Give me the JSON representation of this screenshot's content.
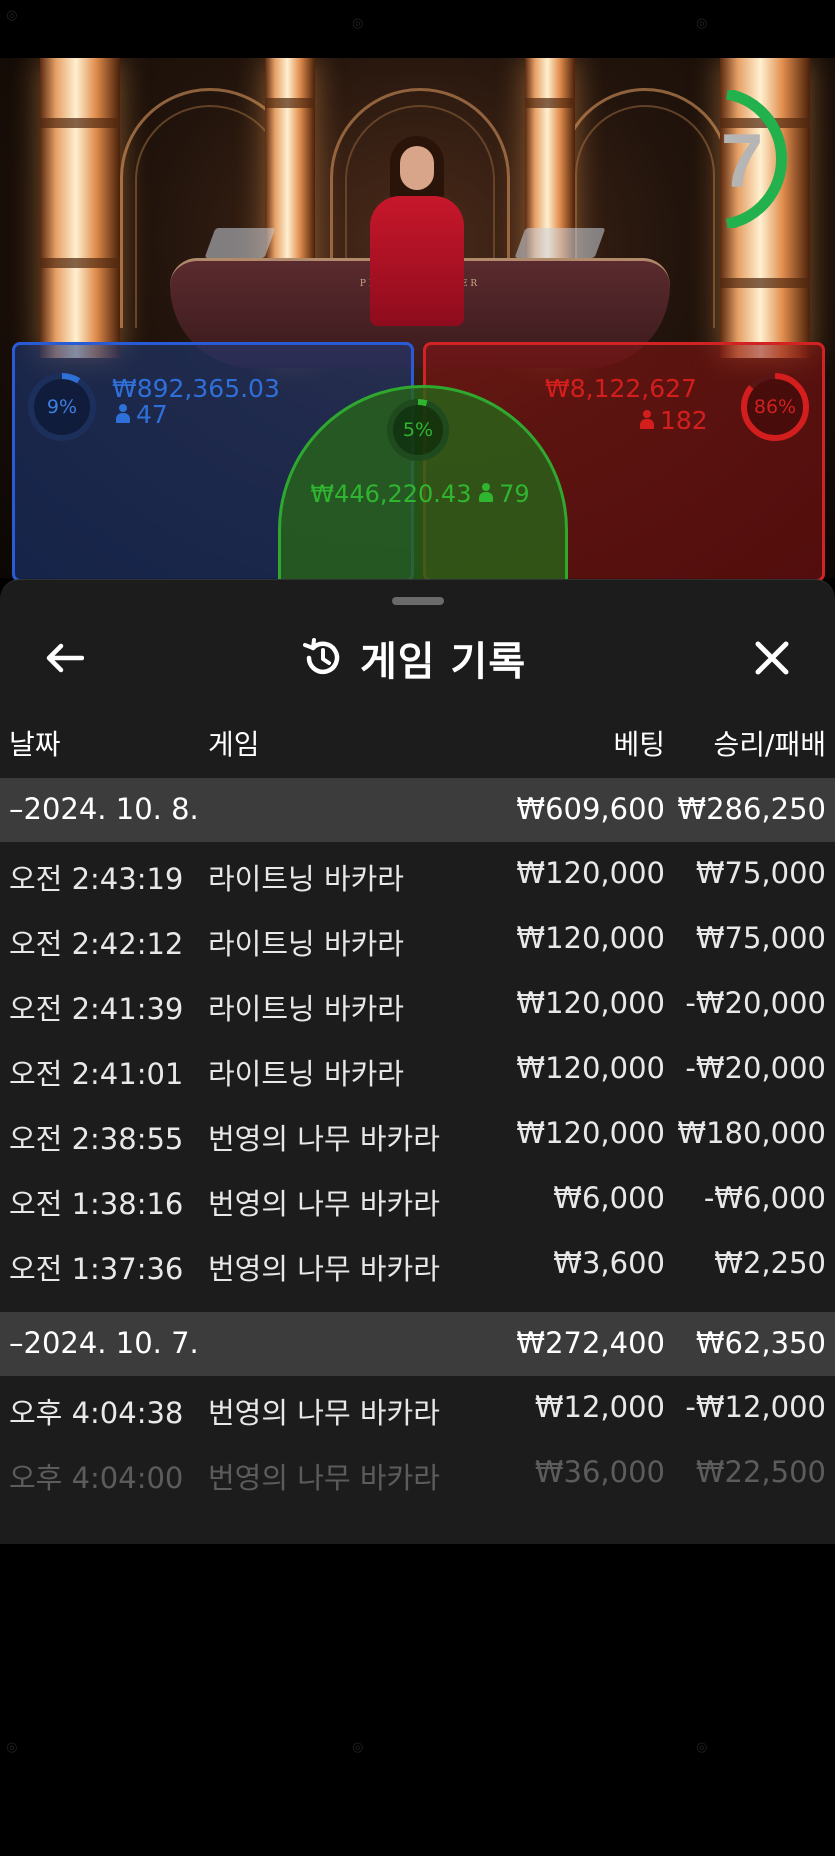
{
  "video": {
    "countdown": "7",
    "table_label": "PLAYER    BANKER"
  },
  "bets": {
    "player": {
      "percent": "9%",
      "percent_value": 0.09,
      "amount": "₩892,365.03",
      "count": "47",
      "color": "#2f6fd8"
    },
    "tie": {
      "percent": "5%",
      "percent_value": 0.05,
      "amount": "₩446,220.43",
      "count": "79",
      "color": "#2fb52f"
    },
    "banker": {
      "percent": "86%",
      "percent_value": 0.86,
      "amount": "₩8,122,627",
      "count": "182",
      "color": "#d41e1e"
    }
  },
  "sheet": {
    "title": "게임 기록",
    "back_icon": "arrow-left-icon",
    "history_icon": "history-icon",
    "close_icon": "close-icon",
    "columns": {
      "date": "날짜",
      "game": "게임",
      "bet": "베팅",
      "result": "승리/패배"
    },
    "groups": [
      {
        "date": "–2024. 10. 8.",
        "total_bet": "₩609,600",
        "total_result": "₩286,250",
        "rows": [
          {
            "time": "오전 2:43:19",
            "game": "라이트닝 바카라",
            "bet": "₩120,000",
            "result": "₩75,000"
          },
          {
            "time": "오전 2:42:12",
            "game": "라이트닝 바카라",
            "bet": "₩120,000",
            "result": "₩75,000"
          },
          {
            "time": "오전 2:41:39",
            "game": "라이트닝 바카라",
            "bet": "₩120,000",
            "result": "-₩20,000"
          },
          {
            "time": "오전 2:41:01",
            "game": "라이트닝 바카라",
            "bet": "₩120,000",
            "result": "-₩20,000"
          },
          {
            "time": "오전 2:38:55",
            "game": "번영의 나무 바카라",
            "bet": "₩120,000",
            "result": "₩180,000"
          },
          {
            "time": "오전 1:38:16",
            "game": "번영의 나무 바카라",
            "bet": "₩6,000",
            "result": "-₩6,000"
          },
          {
            "time": "오전 1:37:36",
            "game": "번영의 나무 바카라",
            "bet": "₩3,600",
            "result": "₩2,250"
          }
        ]
      },
      {
        "date": "–2024. 10. 7.",
        "total_bet": "₩272,400",
        "total_result": "₩62,350",
        "rows": [
          {
            "time": "오후 4:04:38",
            "game": "번영의 나무 바카라",
            "bet": "₩12,000",
            "result": "-₩12,000"
          },
          {
            "time": "오후 4:04:00",
            "game": "번영의 나무 바카라",
            "bet": "₩36,000",
            "result": "₩22,500"
          }
        ]
      }
    ]
  },
  "colors": {
    "sheet_bg": "#1c1c1c",
    "group_bg": "#3c3c3c",
    "timer": "#22b14c"
  }
}
